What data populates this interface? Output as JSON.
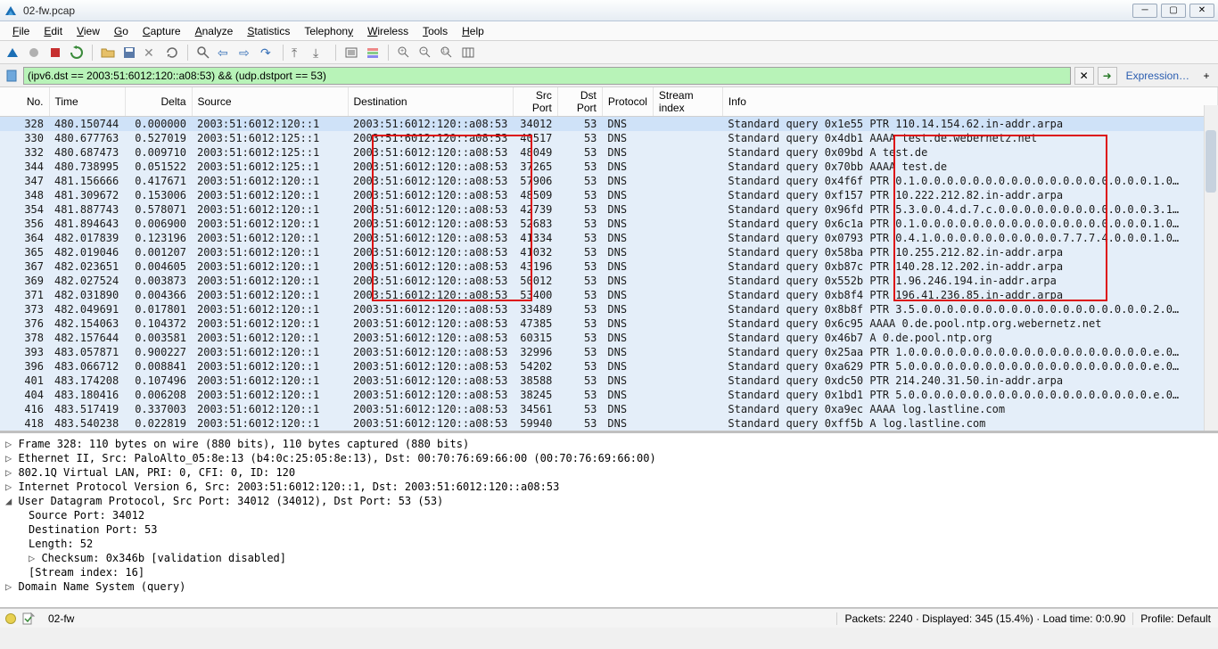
{
  "window": {
    "title": "02-fw.pcap"
  },
  "menu": [
    "File",
    "Edit",
    "View",
    "Go",
    "Capture",
    "Analyze",
    "Statistics",
    "Telephony",
    "Wireless",
    "Tools",
    "Help"
  ],
  "filter": {
    "value": "(ipv6.dst == 2003:51:6012:120::a08:53) && (udp.dstport == 53)",
    "expression_label": "Expression…"
  },
  "columns": [
    "No.",
    "Time",
    "Delta",
    "Source",
    "Destination",
    "Src Port",
    "Dst Port",
    "Protocol",
    "Stream index",
    "Info"
  ],
  "packets": [
    {
      "no": "328",
      "time": "480.150744",
      "delta": "0.000000",
      "src": "2003:51:6012:120::1",
      "dst": "2003:51:6012:120::a08:53",
      "sp": "34012",
      "dp": "53",
      "proto": "DNS",
      "si": "",
      "info": "Standard query 0x1e55 PTR 110.14.154.62.in-addr.arpa",
      "sel": true
    },
    {
      "no": "330",
      "time": "480.677763",
      "delta": "0.527019",
      "src": "2003:51:6012:125::1",
      "dst": "2003:51:6012:120::a08:53",
      "sp": "40517",
      "dp": "53",
      "proto": "DNS",
      "si": "",
      "info": "Standard query 0x4db1 AAAA test.de.webernetz.net"
    },
    {
      "no": "332",
      "time": "480.687473",
      "delta": "0.009710",
      "src": "2003:51:6012:125::1",
      "dst": "2003:51:6012:120::a08:53",
      "sp": "48049",
      "dp": "53",
      "proto": "DNS",
      "si": "",
      "info": "Standard query 0x09bd A test.de"
    },
    {
      "no": "344",
      "time": "480.738995",
      "delta": "0.051522",
      "src": "2003:51:6012:125::1",
      "dst": "2003:51:6012:120::a08:53",
      "sp": "37265",
      "dp": "53",
      "proto": "DNS",
      "si": "",
      "info": "Standard query 0x70bb AAAA test.de"
    },
    {
      "no": "347",
      "time": "481.156666",
      "delta": "0.417671",
      "src": "2003:51:6012:120::1",
      "dst": "2003:51:6012:120::a08:53",
      "sp": "57906",
      "dp": "53",
      "proto": "DNS",
      "si": "",
      "info": "Standard query 0x4f6f PTR 0.1.0.0.0.0.0.0.0.0.0.0.0.0.0.0.0.0.0.0.1.0…"
    },
    {
      "no": "348",
      "time": "481.309672",
      "delta": "0.153006",
      "src": "2003:51:6012:120::1",
      "dst": "2003:51:6012:120::a08:53",
      "sp": "48509",
      "dp": "53",
      "proto": "DNS",
      "si": "",
      "info": "Standard query 0xf157 PTR 10.222.212.82.in-addr.arpa"
    },
    {
      "no": "354",
      "time": "481.887743",
      "delta": "0.578071",
      "src": "2003:51:6012:120::1",
      "dst": "2003:51:6012:120::a08:53",
      "sp": "42739",
      "dp": "53",
      "proto": "DNS",
      "si": "",
      "info": "Standard query 0x96fd PTR 5.3.0.0.4.d.7.c.0.0.0.0.0.0.0.0.0.0.0.0.3.1…"
    },
    {
      "no": "356",
      "time": "481.894643",
      "delta": "0.006900",
      "src": "2003:51:6012:120::1",
      "dst": "2003:51:6012:120::a08:53",
      "sp": "52683",
      "dp": "53",
      "proto": "DNS",
      "si": "",
      "info": "Standard query 0x6c1a PTR 0.1.0.0.0.0.0.0.0.0.0.0.0.0.0.0.0.0.0.0.1.0…"
    },
    {
      "no": "364",
      "time": "482.017839",
      "delta": "0.123196",
      "src": "2003:51:6012:120::1",
      "dst": "2003:51:6012:120::a08:53",
      "sp": "41334",
      "dp": "53",
      "proto": "DNS",
      "si": "",
      "info": "Standard query 0x0793 PTR 0.4.1.0.0.0.0.0.0.0.0.0.0.7.7.7.4.0.0.0.1.0…"
    },
    {
      "no": "365",
      "time": "482.019046",
      "delta": "0.001207",
      "src": "2003:51:6012:120::1",
      "dst": "2003:51:6012:120::a08:53",
      "sp": "41032",
      "dp": "53",
      "proto": "DNS",
      "si": "",
      "info": "Standard query 0x58ba PTR 10.255.212.82.in-addr.arpa"
    },
    {
      "no": "367",
      "time": "482.023651",
      "delta": "0.004605",
      "src": "2003:51:6012:120::1",
      "dst": "2003:51:6012:120::a08:53",
      "sp": "43196",
      "dp": "53",
      "proto": "DNS",
      "si": "",
      "info": "Standard query 0xb87c PTR 140.28.12.202.in-addr.arpa"
    },
    {
      "no": "369",
      "time": "482.027524",
      "delta": "0.003873",
      "src": "2003:51:6012:120::1",
      "dst": "2003:51:6012:120::a08:53",
      "sp": "50012",
      "dp": "53",
      "proto": "DNS",
      "si": "",
      "info": "Standard query 0x552b PTR 1.96.246.194.in-addr.arpa"
    },
    {
      "no": "371",
      "time": "482.031890",
      "delta": "0.004366",
      "src": "2003:51:6012:120::1",
      "dst": "2003:51:6012:120::a08:53",
      "sp": "53400",
      "dp": "53",
      "proto": "DNS",
      "si": "",
      "info": "Standard query 0xb8f4 PTR 196.41.236.85.in-addr.arpa"
    },
    {
      "no": "373",
      "time": "482.049691",
      "delta": "0.017801",
      "src": "2003:51:6012:120::1",
      "dst": "2003:51:6012:120::a08:53",
      "sp": "33489",
      "dp": "53",
      "proto": "DNS",
      "si": "",
      "info": "Standard query 0x8b8f PTR 3.5.0.0.0.0.0.0.0.0.0.0.0.0.0.0.0.0.0.0.2.0…"
    },
    {
      "no": "376",
      "time": "482.154063",
      "delta": "0.104372",
      "src": "2003:51:6012:120::1",
      "dst": "2003:51:6012:120::a08:53",
      "sp": "47385",
      "dp": "53",
      "proto": "DNS",
      "si": "",
      "info": "Standard query 0x6c95 AAAA 0.de.pool.ntp.org.webernetz.net"
    },
    {
      "no": "378",
      "time": "482.157644",
      "delta": "0.003581",
      "src": "2003:51:6012:120::1",
      "dst": "2003:51:6012:120::a08:53",
      "sp": "60315",
      "dp": "53",
      "proto": "DNS",
      "si": "",
      "info": "Standard query 0x46b7 A 0.de.pool.ntp.org"
    },
    {
      "no": "393",
      "time": "483.057871",
      "delta": "0.900227",
      "src": "2003:51:6012:120::1",
      "dst": "2003:51:6012:120::a08:53",
      "sp": "32996",
      "dp": "53",
      "proto": "DNS",
      "si": "",
      "info": "Standard query 0x25aa PTR 1.0.0.0.0.0.0.0.0.0.0.0.0.0.0.0.0.0.0.0.e.0…"
    },
    {
      "no": "396",
      "time": "483.066712",
      "delta": "0.008841",
      "src": "2003:51:6012:120::1",
      "dst": "2003:51:6012:120::a08:53",
      "sp": "54202",
      "dp": "53",
      "proto": "DNS",
      "si": "",
      "info": "Standard query 0xa629 PTR 5.0.0.0.0.0.0.0.0.0.0.0.0.0.0.0.0.0.0.0.e.0…"
    },
    {
      "no": "401",
      "time": "483.174208",
      "delta": "0.107496",
      "src": "2003:51:6012:120::1",
      "dst": "2003:51:6012:120::a08:53",
      "sp": "38588",
      "dp": "53",
      "proto": "DNS",
      "si": "",
      "info": "Standard query 0xdc50 PTR 214.240.31.50.in-addr.arpa"
    },
    {
      "no": "404",
      "time": "483.180416",
      "delta": "0.006208",
      "src": "2003:51:6012:120::1",
      "dst": "2003:51:6012:120::a08:53",
      "sp": "38245",
      "dp": "53",
      "proto": "DNS",
      "si": "",
      "info": "Standard query 0x1bd1 PTR 5.0.0.0.0.0.0.0.0.0.0.0.0.0.0.0.0.0.0.0.e.0…"
    },
    {
      "no": "416",
      "time": "483.517419",
      "delta": "0.337003",
      "src": "2003:51:6012:120::1",
      "dst": "2003:51:6012:120::a08:53",
      "sp": "34561",
      "dp": "53",
      "proto": "DNS",
      "si": "",
      "info": "Standard query 0xa9ec AAAA log.lastline.com"
    },
    {
      "no": "418",
      "time": "483.540238",
      "delta": "0.022819",
      "src": "2003:51:6012:120::1",
      "dst": "2003:51:6012:120::a08:53",
      "sp": "59940",
      "dp": "53",
      "proto": "DNS",
      "si": "",
      "info": "Standard query 0xff5b A log.lastline.com"
    }
  ],
  "details": [
    {
      "cls": "tri",
      "txt": "Frame 328: 110 bytes on wire (880 bits), 110 bytes captured (880 bits)"
    },
    {
      "cls": "tri",
      "txt": "Ethernet II, Src: PaloAlto_05:8e:13 (b4:0c:25:05:8e:13), Dst: 00:70:76:69:66:00 (00:70:76:69:66:00)"
    },
    {
      "cls": "tri",
      "txt": "802.1Q Virtual LAN, PRI: 0, CFI: 0, ID: 120"
    },
    {
      "cls": "tri",
      "txt": "Internet Protocol Version 6, Src: 2003:51:6012:120::1, Dst: 2003:51:6012:120::a08:53"
    },
    {
      "cls": "trid",
      "txt": "User Datagram Protocol, Src Port: 34012 (34012), Dst Port: 53 (53)"
    },
    {
      "cls": "ind1",
      "txt": "Source Port: 34012"
    },
    {
      "cls": "ind1",
      "txt": "Destination Port: 53"
    },
    {
      "cls": "ind1",
      "txt": "Length: 52"
    },
    {
      "cls": "tri ind2",
      "txt": "Checksum: 0x346b [validation disabled]"
    },
    {
      "cls": "ind1",
      "txt": "[Stream index: 16]"
    },
    {
      "cls": "tri",
      "txt": "Domain Name System (query)"
    }
  ],
  "status": {
    "file": "02-fw",
    "center": "Packets: 2240 · Displayed: 345 (15.4%) · Load time: 0:0.90",
    "profile": "Profile: Default"
  }
}
